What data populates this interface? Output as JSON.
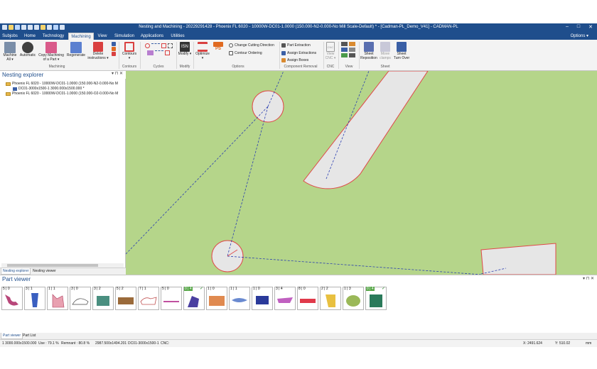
{
  "title_bar": {
    "title": "Nesting and Machining - 20229291428 - Phoenix FL 6020 - 10000W-DC01-1.0000 (150.000-N2-0.000-No Mill Scale-Default) * - [Cadman-PL_Demo_V41] - CADMAN-PL",
    "minimize": "–",
    "maximize": "□",
    "close": "✕"
  },
  "menu": {
    "tabs": [
      "Subjobs",
      "Home",
      "Technology",
      "Machining",
      "View",
      "Simulation",
      "Applications",
      "Utilities"
    ],
    "active": "Machining",
    "options": "Options ▾"
  },
  "ribbon": {
    "machine_all": "Machine All ▾",
    "automatic": "Automatic",
    "copy_machining": "Copy Machining of a Part ▾",
    "regenerate": "Regenerate",
    "delete_instructions": "Delete instructions ▾",
    "contours": "Contours ▾",
    "modify": "Modify ▾",
    "optimize": "Optimize ▾",
    "change_cutting_direction": "Change Cutting Direction",
    "contour_ordering": "Contour Ordering",
    "part_extraction": "Part Extraction",
    "assign_extractions": "Assign Extractions",
    "assign_boxes": "Assign Boxes",
    "view_cnc": "View CNC ▾",
    "sheet_reposition": "Sheet Reposition",
    "move_clamps": "Move clamps",
    "sheet_turn_over": "Sheet Turn Over",
    "isn": "ISN",
    "ps": "PS",
    "groups": [
      "Machining",
      "Contours",
      "Cycles",
      "Modify",
      "Options",
      "Component Removal",
      "CNC",
      "View",
      "Sheet"
    ]
  },
  "explorer": {
    "title": "Nesting explorer",
    "pin": "▾ ⊓ ✕",
    "items": [
      "Phoenix FL 6020 - 10000W-DC01-1.0000 (150.000-N2-0.000-No M",
      "DC01-3000x1500-1 3000.000x1500.000 *",
      "Phoenix FL 6020 - 10000W-DC01-1.0000 (150.000-O2-0.000-No M"
    ],
    "tabs": [
      "Nesting explorer",
      "Nesting viewer"
    ]
  },
  "part_viewer": {
    "title": "Part viewer",
    "pin": "▾ ⊓ ✕",
    "parts": [
      {
        "count": "5 | 0",
        "done": false
      },
      {
        "count": "3 | 1",
        "done": false
      },
      {
        "count": "1 | 1",
        "done": false
      },
      {
        "count": "3 | 0",
        "done": false
      },
      {
        "count": "3 | 2",
        "done": false
      },
      {
        "count": "5 | 2",
        "done": false
      },
      {
        "count": "7 | 1",
        "done": false
      },
      {
        "count": "5 | 0",
        "done": false
      },
      {
        "count": "0 | 4",
        "done": true
      },
      {
        "count": "1 | 0",
        "done": false
      },
      {
        "count": "1 | 1",
        "done": false
      },
      {
        "count": "1 | 0",
        "done": false
      },
      {
        "count": "3 | 4",
        "done": false
      },
      {
        "count": "8 | 0",
        "done": false
      },
      {
        "count": "2 | 2",
        "done": false
      },
      {
        "count": "1 | 3",
        "done": false
      },
      {
        "count": "0 | 4",
        "done": true
      }
    ],
    "tabs": [
      "Part viewer",
      "Part List"
    ]
  },
  "status": {
    "sheet": "1  3000.000x1500.000",
    "use": "Use : 79.1 %",
    "remnant": "Remnant : 80.8 %",
    "remnant_size": "2987.500x1494.201",
    "sheet_name": "DC01-3000x1500-1",
    "cnc": "CNC:",
    "x": "X: 2491.624",
    "y": "Y: 510.02",
    "unit": "mm"
  },
  "colors": {
    "title_blue": "#1f4e8c",
    "sheet_green": "#b5d58a",
    "part_grey": "#e6e6e6",
    "contour_red": "#e04848",
    "path_blue": "#2b3fb0"
  }
}
